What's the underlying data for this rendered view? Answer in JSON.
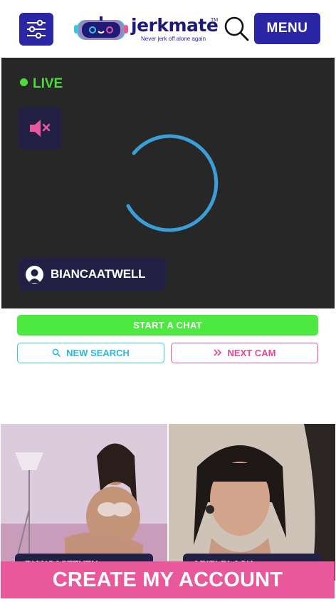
{
  "header": {
    "logo_word": "jerkmate",
    "logo_tm": "TM",
    "logo_tagline": "Never jerk off alone again",
    "menu_label": "MENU"
  },
  "player": {
    "live_label": "LIVE",
    "model_name": "BIANCAATWELL"
  },
  "actions": {
    "start_chat": "START A CHAT",
    "new_search": "NEW SEARCH",
    "next_cam": "NEXT CAM"
  },
  "thumbnails": [
    {
      "label": "BIANCASTEVEN"
    },
    {
      "label": "ARIELBLACK"
    }
  ],
  "cta": {
    "label": "CREATE MY ACCOUNT"
  },
  "icons": {
    "filter": "sliders-icon",
    "search": "search-icon",
    "mute": "speaker-muted-icon",
    "new_search": "search-icon",
    "next_cam": "double-chevron-right-icon",
    "avatar": "user-silhouette-icon"
  },
  "colors": {
    "brand_blue": "#2b26a5",
    "live_green": "#4ddc3b",
    "start_green": "#4de840",
    "cyan": "#29b8d6",
    "pink": "#e8589b",
    "player_bg": "#272727",
    "spinner": "#3a9fd8"
  }
}
